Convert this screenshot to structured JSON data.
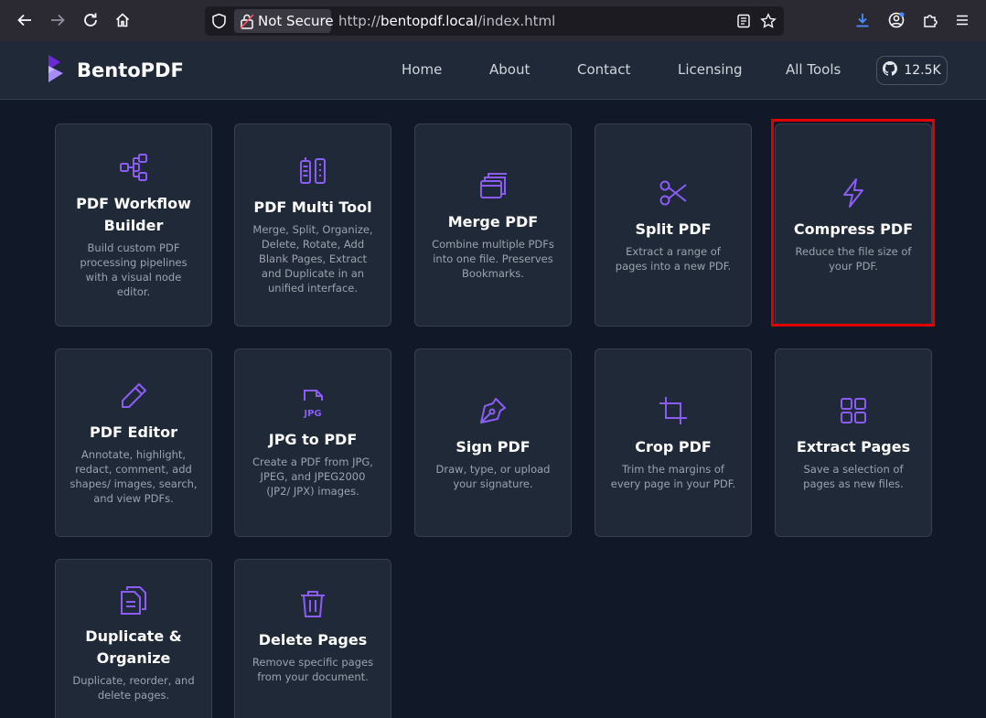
{
  "browser": {
    "security_label": "Not Secure",
    "url_prefix": "http://",
    "url_host": "bentopdf.local",
    "url_path": "/index.html"
  },
  "header": {
    "brand": "BentoPDF",
    "nav": [
      "Home",
      "About",
      "Contact",
      "Licensing",
      "All Tools"
    ],
    "github_stars": "12.5K"
  },
  "tools": [
    {
      "title": "PDF Workflow Builder",
      "desc": "Build custom PDF processing pipelines with a visual node editor.",
      "icon": "workflow-icon"
    },
    {
      "title": "PDF Multi Tool",
      "desc": "Merge, Split, Organize, Delete, Rotate, Add Blank Pages, Extract and Duplicate in an unified interface.",
      "icon": "tools-icon"
    },
    {
      "title": "Merge PDF",
      "desc": "Combine multiple PDFs into one file. Preserves Bookmarks.",
      "icon": "stack-icon"
    },
    {
      "title": "Split PDF",
      "desc": "Extract a range of pages into a new PDF.",
      "icon": "scissors-icon"
    },
    {
      "title": "Compress PDF",
      "desc": "Reduce the file size of your PDF.",
      "icon": "lightning-icon"
    },
    {
      "title": "PDF Editor",
      "desc": "Annotate, highlight, redact, comment, add shapes/ images, search, and view PDFs.",
      "icon": "pencil-icon"
    },
    {
      "title": "JPG to PDF",
      "desc": "Create a PDF from JPG, JPEG, and JPEG2000 (JP2/ JPX) images.",
      "icon": "jpg-file-icon"
    },
    {
      "title": "Sign PDF",
      "desc": "Draw, type, or upload your signature.",
      "icon": "pen-nib-icon"
    },
    {
      "title": "Crop PDF",
      "desc": "Trim the margins of every page in your PDF.",
      "icon": "crop-icon"
    },
    {
      "title": "Extract Pages",
      "desc": "Save a selection of pages as new files.",
      "icon": "grid-icon"
    },
    {
      "title": "Duplicate & Organize",
      "desc": "Duplicate, reorder, and delete pages.",
      "icon": "copy-file-icon"
    },
    {
      "title": "Delete Pages",
      "desc": "Remove specific pages from your document.",
      "icon": "trash-icon"
    }
  ],
  "colors": {
    "accent": "#8b5cf6",
    "card_bg": "#1f2937",
    "page_bg": "#111827",
    "highlight": "#e00000"
  }
}
